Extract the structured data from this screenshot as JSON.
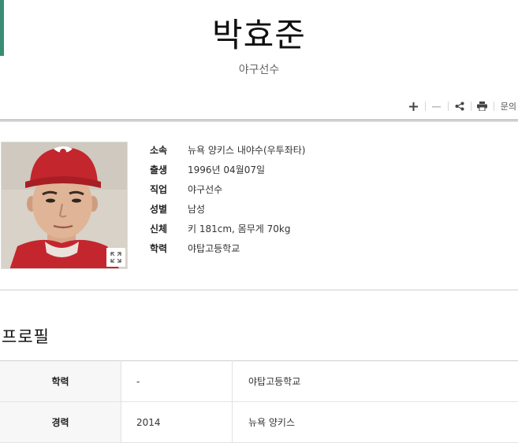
{
  "header": {
    "title": "박효준",
    "subtitle": "야구선수"
  },
  "toolbar": {
    "zoom_in_icon": "plus-icon",
    "zoom_out_icon": "minus-icon",
    "share_icon": "share-icon",
    "print_icon": "print-icon",
    "inquiry_label": "문의"
  },
  "person": {
    "photo_alt": "박효준 사진",
    "info": [
      {
        "label": "소속",
        "value": "뉴욕 양키스 내야수(우투좌타)"
      },
      {
        "label": "출생",
        "value": "1996년 04월07일"
      },
      {
        "label": "직업",
        "value": "야구선수"
      },
      {
        "label": "성별",
        "value": "남성"
      },
      {
        "label": "신체",
        "value": "키 181cm, 몸무게 70kg"
      },
      {
        "label": "학력",
        "value": "야탑고등학교"
      }
    ]
  },
  "profile": {
    "title": "프로필",
    "rows": [
      {
        "label": "학력",
        "year": "-",
        "desc": "야탑고등학교"
      },
      {
        "label": "경력",
        "year": "2014",
        "desc": "뉴욕 양키스"
      }
    ]
  },
  "colors": {
    "accent": "#3a8c74",
    "cap_red": "#c4262e"
  }
}
